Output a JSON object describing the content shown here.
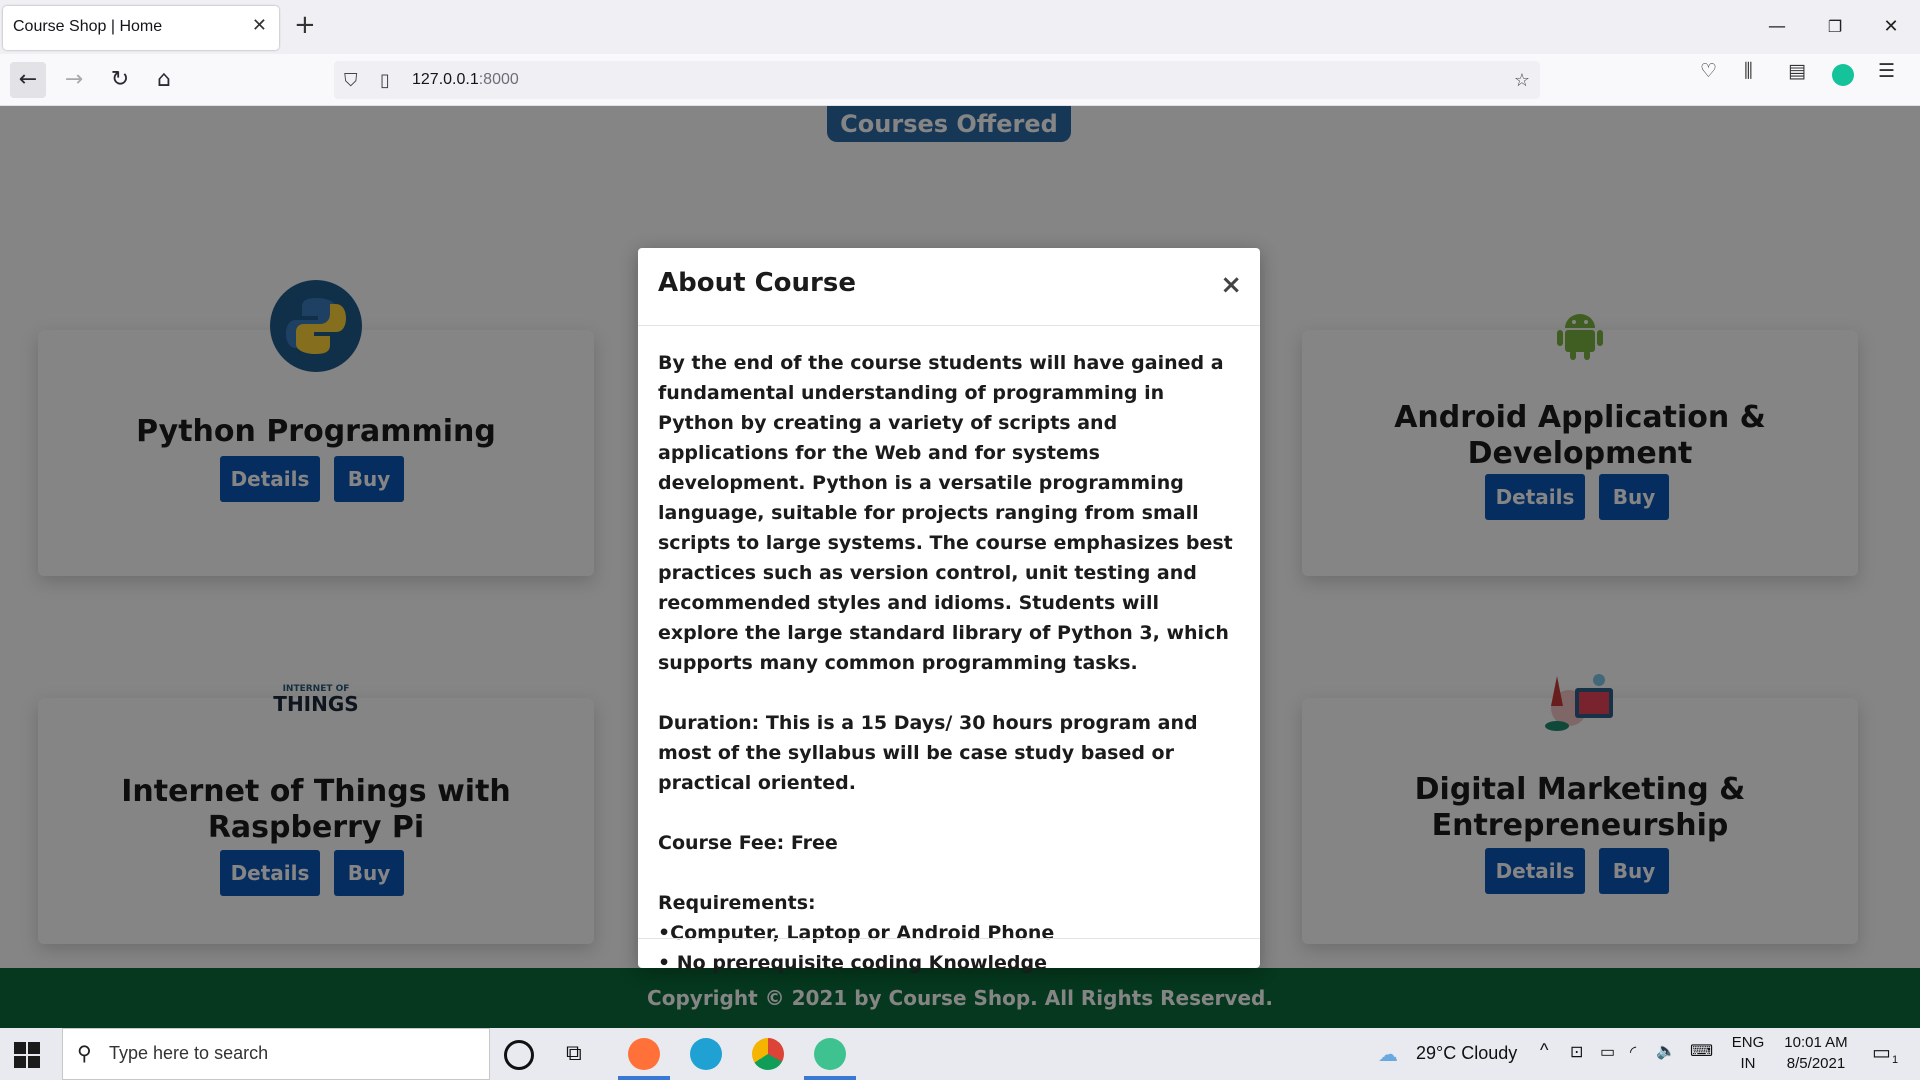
{
  "browser": {
    "tab_title": "Course Shop | Home",
    "url_host": "127.0.0.1",
    "url_port": ":8000"
  },
  "page": {
    "section_title": "Courses Offered",
    "courses": [
      {
        "title_line1": "Python Programming",
        "title_line2": "",
        "icon": "python-logo-icon"
      },
      {
        "title_line1": "Android Application &",
        "title_line2": "Development",
        "icon": "android-icon"
      },
      {
        "title_line1": "Internet of Things with",
        "title_line2": "Raspberry Pi",
        "icon": "iot-things-icon"
      },
      {
        "title_line1": "Digital Marketing &",
        "title_line2": "Entrepreneurship",
        "icon": "marketing-icon"
      }
    ],
    "details_label": "Details",
    "buy_label": "Buy",
    "footer": "Copyright © 2021 by Course Shop. All Rights Reserved."
  },
  "modal": {
    "title": "About Course",
    "close_glyph": "×",
    "description": "By the end of the course students will have gained a fundamental understanding of programming in Python by creating a variety of scripts and applications for the Web and for systems development. Python is a versatile programming language, suitable for projects ranging from small scripts to large systems. The course emphasizes best practices such as version control, unit testing and recommended styles and idioms. Students will explore the large standard library of Python 3, which supports many common programming tasks.",
    "duration": "Duration:  This is a 15 Days/ 30 hours program and most of the syllabus will be case study based or practical oriented.",
    "fee": "Course Fee: Free",
    "requirements_label": "Requirements:",
    "requirements": [
      "•Computer, Laptop or Android Phone",
      "• No prerequisite coding Knowledge"
    ]
  },
  "taskbar": {
    "search_placeholder": "Type here to search",
    "weather": "29°C  Cloudy",
    "lang_line1": "ENG",
    "lang_line2": "IN",
    "time": "10:01 AM",
    "date": "8/5/2021",
    "notification_count": "1"
  },
  "colors": {
    "button_blue": "#0d56b8",
    "footer_green": "#0b6b3a",
    "section_blue": "#2d6aa8"
  }
}
